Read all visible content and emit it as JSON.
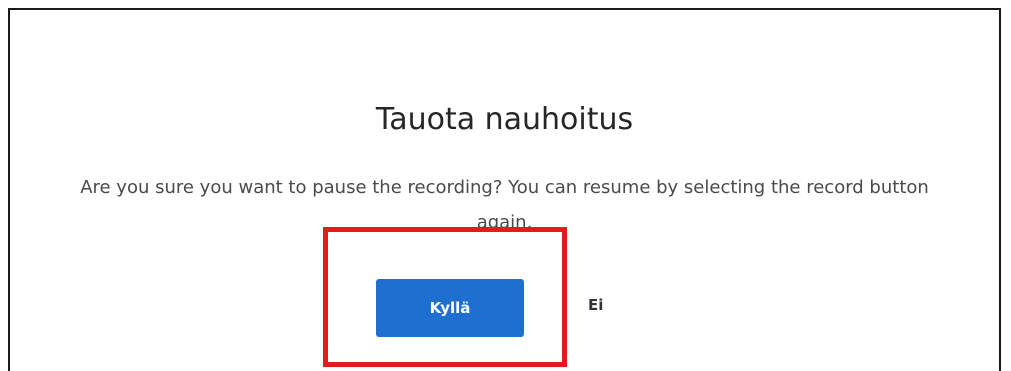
{
  "dialog": {
    "title": "Tauota nauhoitus",
    "message": "Are you sure you want to pause the recording? You can resume by selecting the record button again.",
    "confirm_label": "Kyllä",
    "cancel_label": "Ei"
  },
  "colors": {
    "primary_button": "#1f6fd1",
    "highlight_border": "#e41b1b"
  }
}
